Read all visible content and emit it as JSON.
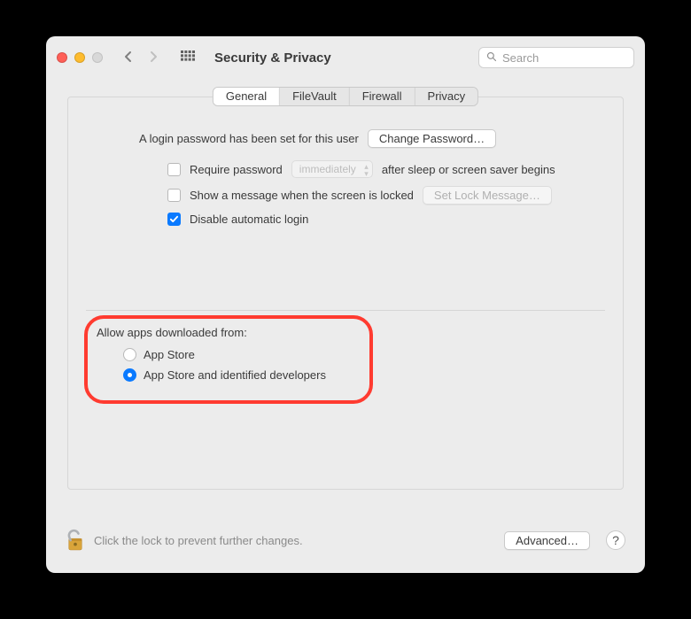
{
  "window": {
    "title": "Security & Privacy",
    "search_placeholder": "Search"
  },
  "tabs": {
    "general": "General",
    "filevault": "FileVault",
    "firewall": "Firewall",
    "privacy": "Privacy",
    "active": "general"
  },
  "general": {
    "login_pw_text": "A login password has been set for this user",
    "change_pw_btn": "Change Password…",
    "require_pw_label": "Require password",
    "require_pw_checked": false,
    "delay_value": "immediately",
    "require_pw_after": "after sleep or screen saver begins",
    "show_message_label": "Show a message when the screen is locked",
    "show_message_checked": false,
    "set_lock_msg_btn": "Set Lock Message…",
    "disable_auto_login_label": "Disable automatic login",
    "disable_auto_login_checked": true,
    "allow_apps_title": "Allow apps downloaded from:",
    "radio_app_store": "App Store",
    "radio_app_store_identified": "App Store and identified developers",
    "selected_radio": "identified"
  },
  "footer": {
    "lock_text": "Click the lock to prevent further changes.",
    "advanced_btn": "Advanced…",
    "help": "?"
  }
}
